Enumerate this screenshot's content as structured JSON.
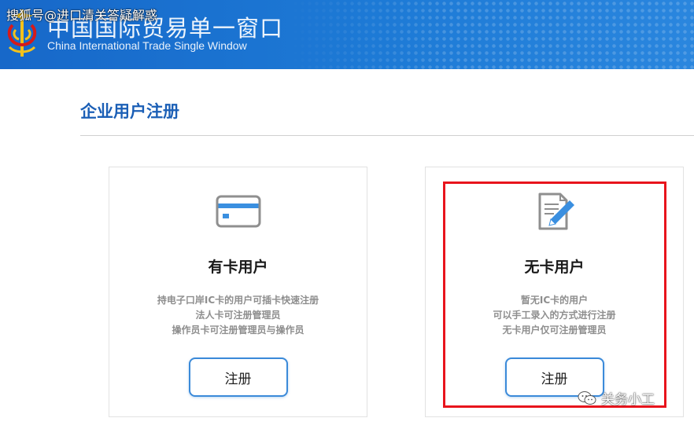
{
  "header": {
    "title_cn": "中国国际贸易单一窗口",
    "title_en": "China International Trade Single  Window",
    "emblem_icon": "customs-emblem-icon"
  },
  "watermark_top": "搜狐号@进口清关答疑解惑",
  "section": {
    "title": "企业用户注册"
  },
  "cards": [
    {
      "icon": "ic-card-icon",
      "title": "有卡用户",
      "desc": [
        "持电子口岸IC卡的用户可插卡快速注册",
        "法人卡可注册管理员",
        "操作员卡可注册管理员与操作员"
      ],
      "button": "注册"
    },
    {
      "icon": "manual-entry-icon",
      "title": "无卡用户",
      "desc": [
        "暂无IC卡的用户",
        "可以手工录入的方式进行注册",
        "无卡用户仅可注册管理员"
      ],
      "button": "注册"
    }
  ],
  "watermark_bottom": "关务小工",
  "colors": {
    "banner": "#1d7ad6",
    "heading": "#1b5fb6",
    "button_border": "#3b8ad9",
    "highlight": "#e8141c"
  }
}
